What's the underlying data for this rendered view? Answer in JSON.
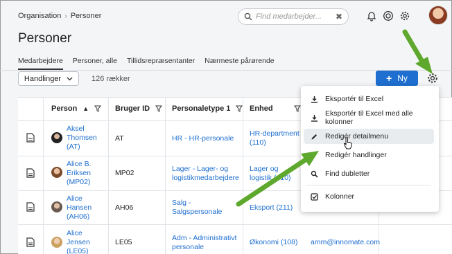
{
  "breadcrumb": {
    "root": "Organisation",
    "current": "Personer"
  },
  "search": {
    "placeholder": "Find medarbejder..."
  },
  "page_title": "Personer",
  "tabs": [
    {
      "label": "Medarbejdere",
      "active": true
    },
    {
      "label": "Personer, alle"
    },
    {
      "label": "Tillidsrepræsentanter"
    },
    {
      "label": "Nærmeste pårørende"
    }
  ],
  "toolbar": {
    "actions_label": "Handlinger",
    "row_count": "126 rækker",
    "new_label": "Ny"
  },
  "table": {
    "headers": {
      "person": "Person",
      "user_id": "Bruger ID",
      "persontype": "Personaletype 1",
      "unit": "Enhed"
    },
    "rows": [
      {
        "name": "Aksel\nThomsen\n(AT)",
        "user_id": "AT",
        "persontype": "HR - HR-personale",
        "unit": "HR-department\n(110)",
        "email": ""
      },
      {
        "name": "Alice B.\nEriksen\n(MP02)",
        "user_id": "MP02",
        "persontype": "Lager - Lager- og\nlogistikmedarbejdere",
        "unit": "Lager og\nlogistik (410)",
        "email": ""
      },
      {
        "name": "Alice\nHansen\n(AH06)",
        "user_id": "AH06",
        "persontype": "Salg -\nSalgspersonale",
        "unit": "Eksport (211)",
        "email": ""
      },
      {
        "name": "Alice\nJensen\n(LE05)",
        "user_id": "LE05",
        "persontype": "Adm - Administrativt\npersonale",
        "unit": "Økonomi (108)",
        "email": "amm@innomate.com"
      }
    ]
  },
  "menu": {
    "items": [
      {
        "label": "Eksportér til Excel",
        "icon": "download-icon"
      },
      {
        "label": "Eksportér til Excel med alle kolonner",
        "icon": "download-icon"
      },
      {
        "label": "Redigér detailmenu",
        "icon": "pencil-icon"
      },
      {
        "label": "Redigér handlinger",
        "icon": "pencil-icon"
      },
      {
        "label": "Find dubletter",
        "icon": "search-icon"
      },
      {
        "label": "Kolonner",
        "icon": "checkbox-icon"
      }
    ]
  },
  "colors": {
    "accent": "#1e6fd0",
    "arrow": "#5ea82e"
  }
}
